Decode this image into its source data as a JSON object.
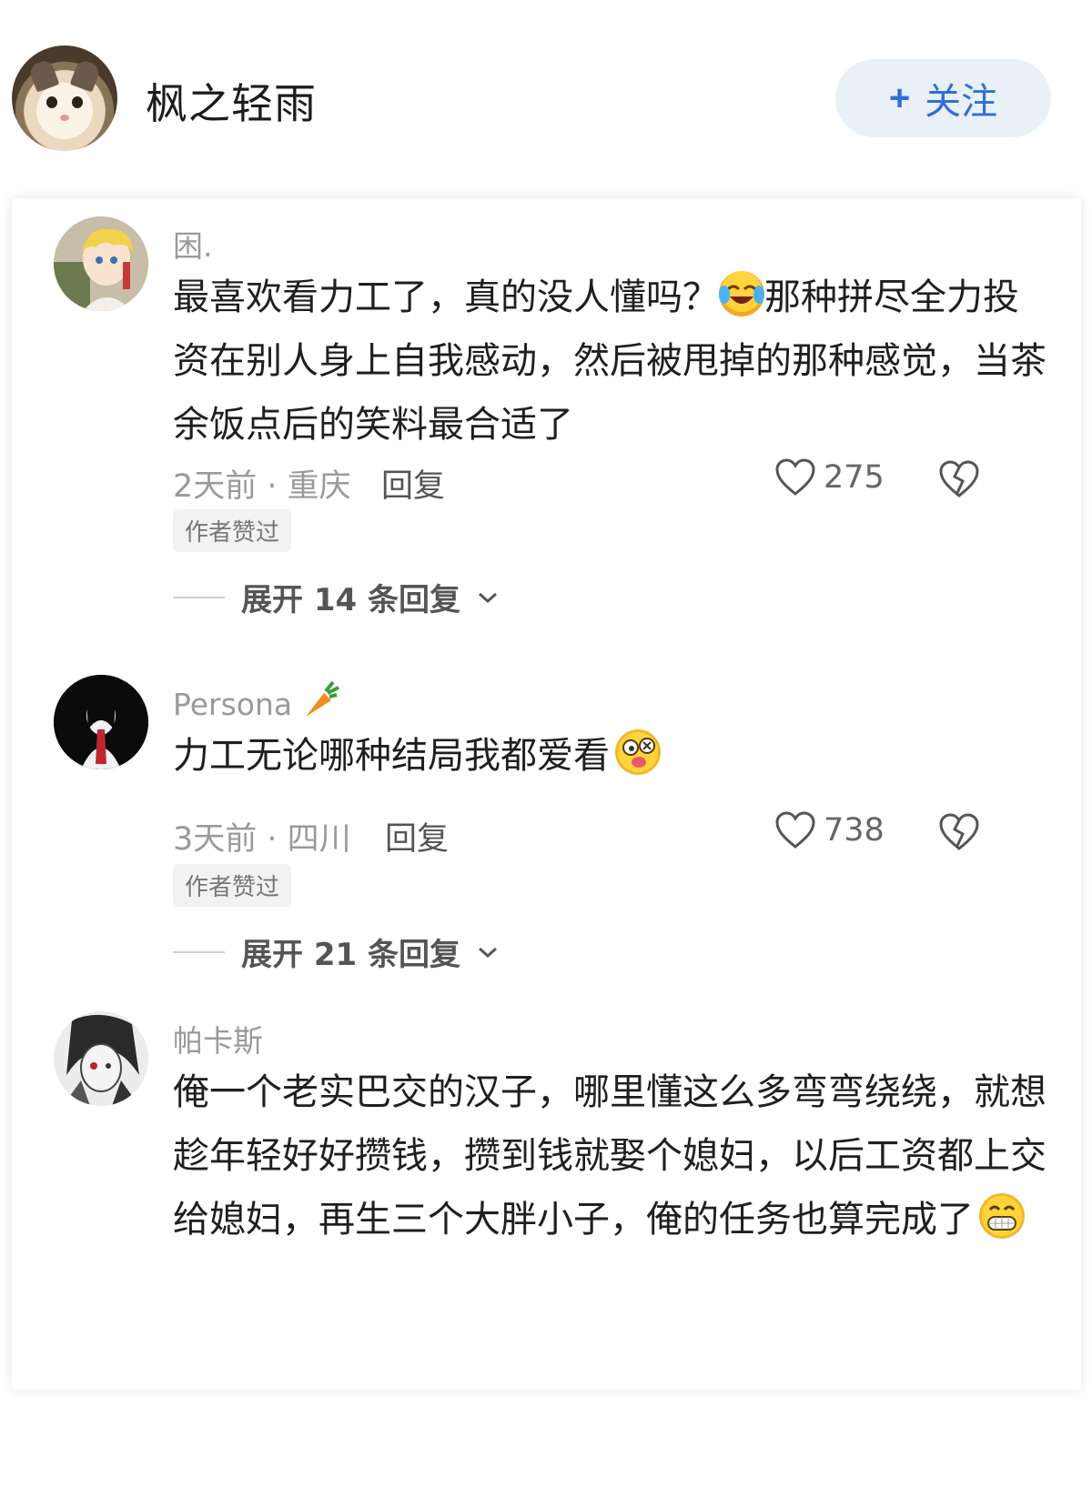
{
  "header": {
    "username": "枫之轻雨",
    "follow_label": "关注",
    "follow_plus": "+"
  },
  "comments": [
    {
      "name": "困.",
      "text_a": "最喜欢看力工了，真的没人懂吗？",
      "text_b": "那种拼尽全力投资在别人身上自我感动，然后被甩掉的那种感觉，当茶余饭点后的笑料最合适了",
      "time_location": "2天前 · 重庆",
      "reply_label": "回复",
      "likes": "275",
      "badge": "作者赞过",
      "expand_label": "展开 14 条回复"
    },
    {
      "name": "Persona",
      "text_a": "力工无论哪种结局我都爱看",
      "time_location": "3天前 · 四川",
      "reply_label": "回复",
      "likes": "738",
      "badge": "作者赞过",
      "expand_label": "展开 21 条回复"
    },
    {
      "name": "帕卡斯",
      "text_a": "俺一个老实巴交的汉子，哪里懂这么多弯弯绕绕，就想趁年轻好好攒钱，攒到钱就娶个媳妇，以后工资都上交给媳妇，再生三个大胖小子，俺的任务也算完成了"
    }
  ],
  "icons": {
    "like": "heart-outline-icon",
    "dislike": "broken-heart-icon",
    "expand": "chevron-down-icon",
    "name_decoration": "carrot-icon"
  },
  "colors": {
    "accent": "#2f6fd6",
    "follow_bg": "#e9f0f8",
    "muted": "#9a9a9a"
  }
}
